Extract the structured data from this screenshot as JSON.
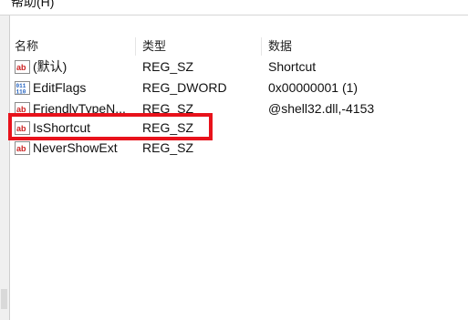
{
  "menu": {
    "help_label": "帮助(H)"
  },
  "columns": {
    "name": "名称",
    "type": "类型",
    "data": "数据"
  },
  "rows": [
    {
      "name": "(默认)",
      "type": "REG_SZ",
      "data": "Shortcut",
      "icon": "string-value-icon"
    },
    {
      "name": "EditFlags",
      "type": "REG_DWORD",
      "data": "0x00000001 (1)",
      "icon": "binary-value-icon"
    },
    {
      "name": "FriendlyTypeN...",
      "type": "REG_SZ",
      "data": "@shell32.dll,-4153",
      "icon": "string-value-icon"
    },
    {
      "name": "IsShortcut",
      "type": "REG_SZ",
      "data": "",
      "icon": "string-value-icon"
    },
    {
      "name": "NeverShowExt",
      "type": "REG_SZ",
      "data": "",
      "icon": "string-value-icon"
    }
  ],
  "colors": {
    "highlight_border": "#e8121b",
    "string_icon_red": "#cc2222",
    "binary_icon_blue": "#1f5fbf"
  }
}
